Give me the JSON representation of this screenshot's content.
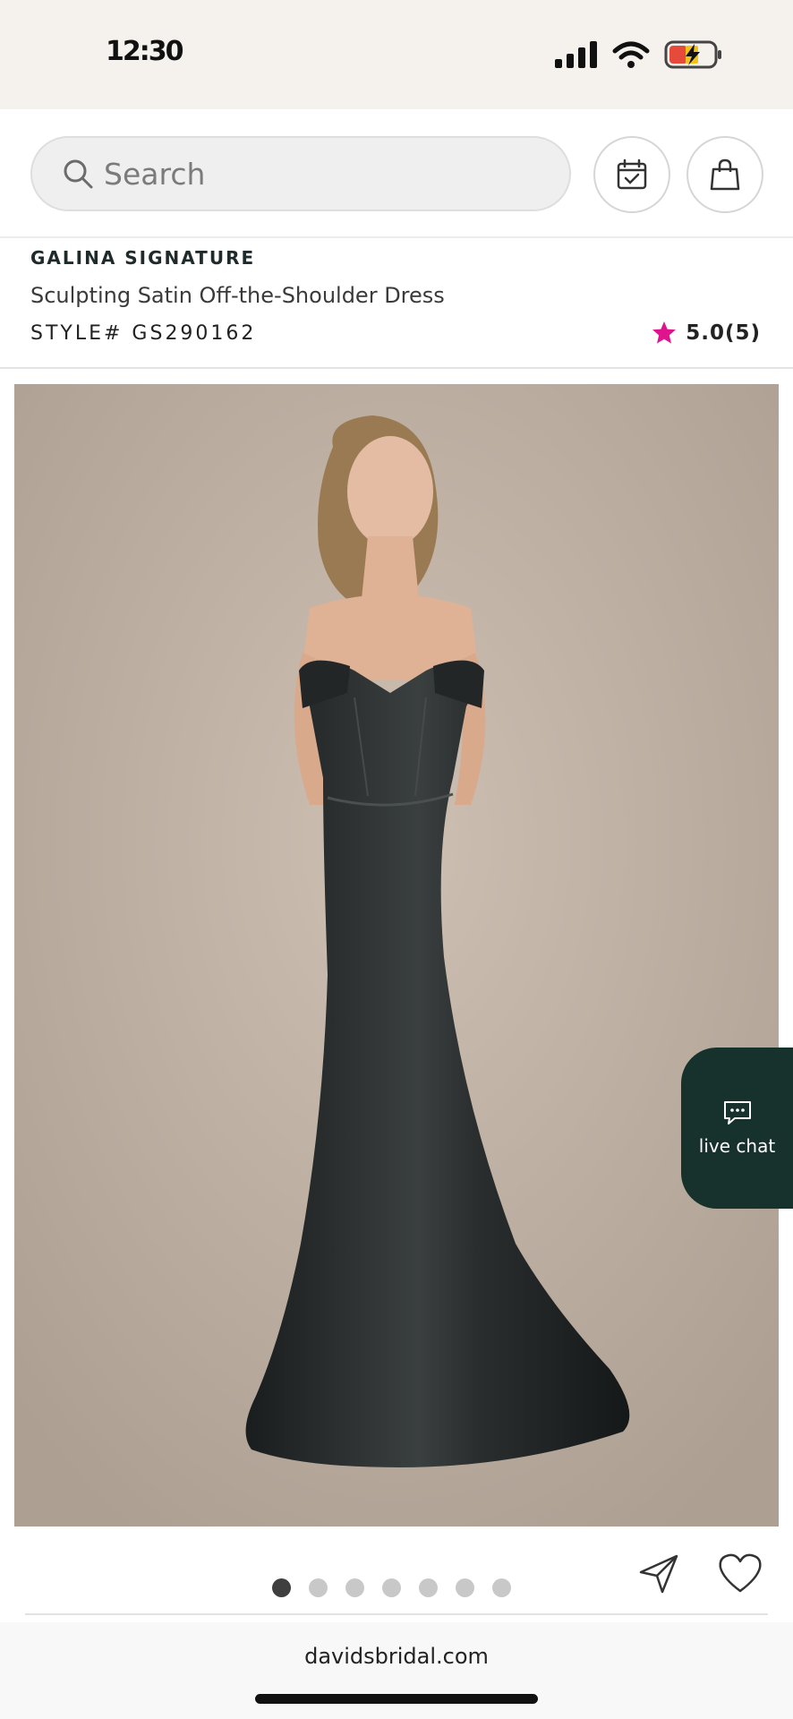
{
  "status_bar": {
    "time": "12:30",
    "battery_state": "charging"
  },
  "header": {
    "search_placeholder": "Search",
    "icons": [
      "search-icon",
      "calendar-icon",
      "shopping-bag-icon"
    ]
  },
  "product": {
    "brand": "GALINA SIGNATURE",
    "name": "Sculpting Satin Off-the-Shoulder Dress",
    "style_number": "STYLE# GS290162",
    "rating": "5.0(5)",
    "rating_star_color": "#e0138c"
  },
  "gallery": {
    "total_images": 7,
    "active_index": 0
  },
  "live_chat": {
    "label": "live chat",
    "color": "#17312d"
  },
  "actions": {
    "icons": [
      "share-icon",
      "heart-icon"
    ]
  },
  "browser": {
    "url": "davidsbridal.com"
  }
}
